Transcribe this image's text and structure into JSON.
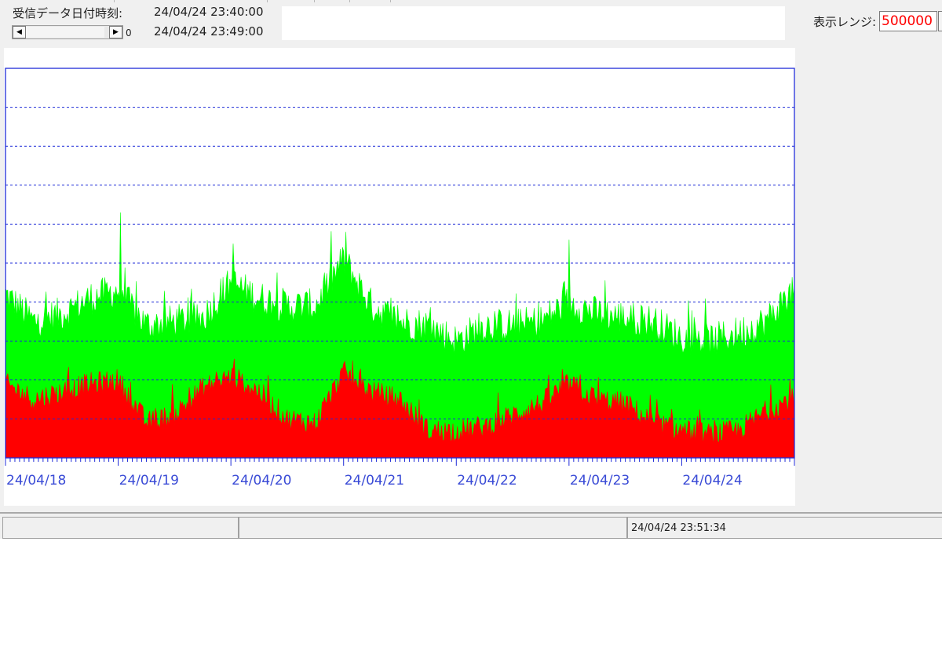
{
  "header": {
    "received_label": "受信データ日付時刻:",
    "time_from": "24/04/24 23:40:00",
    "time_to": "24/04/24 23:49:00",
    "scroll_value": "0",
    "scroll_left_icon": "◀",
    "scroll_right_icon": "▶"
  },
  "range": {
    "label": "表示レンジ:",
    "value": "500000"
  },
  "colors": {
    "series_total": "#00ff00",
    "series_part": "#ff0000",
    "axis": "#1f2bd8",
    "grid": "#1f2bd8",
    "tick_label": "#3a4bd6"
  },
  "chart_data": {
    "type": "area",
    "title": "",
    "xlabel": "",
    "ylabel": "",
    "x_tick_labels": [
      "24/04/18",
      "24/04/19",
      "24/04/20",
      "24/04/21",
      "24/04/22",
      "24/04/23",
      "24/04/24"
    ],
    "ylim": [
      0,
      500000
    ],
    "y_gridlines": [
      50000,
      100000,
      150000,
      200000,
      250000,
      300000,
      350000,
      400000,
      450000
    ],
    "grid": true,
    "grid_style": "dotted",
    "legend": "none",
    "hourly_ticks_per_day": 24,
    "series": [
      {
        "color": "#00ff00",
        "x": [
          "24/04/18 00:00",
          "24/04/18 06:00",
          "24/04/18 12:00",
          "24/04/18 18:00",
          "24/04/19 00:00",
          "24/04/19 06:00",
          "24/04/19 12:00",
          "24/04/19 18:00",
          "24/04/20 00:00",
          "24/04/20 06:00",
          "24/04/20 12:00",
          "24/04/20 18:00",
          "24/04/21 00:00",
          "24/04/21 06:00",
          "24/04/21 12:00",
          "24/04/21 18:00",
          "24/04/22 00:00",
          "24/04/22 06:00",
          "24/04/22 12:00",
          "24/04/22 18:00",
          "24/04/23 00:00",
          "24/04/23 06:00",
          "24/04/23 12:00",
          "24/04/23 18:00",
          "24/04/24 00:00",
          "24/04/24 06:00",
          "24/04/24 12:00",
          "24/04/24 18:00",
          "24/04/24 23:00"
        ],
        "values": [
          210000,
          175000,
          185000,
          205000,
          215000,
          170000,
          175000,
          180000,
          225000,
          205000,
          195000,
          195000,
          255000,
          195000,
          175000,
          170000,
          150000,
          170000,
          170000,
          175000,
          200000,
          185000,
          180000,
          175000,
          155000,
          150000,
          160000,
          175000,
          210000
        ]
      },
      {
        "color": "#ff0000",
        "x": [
          "24/04/18 00:00",
          "24/04/18 06:00",
          "24/04/18 12:00",
          "24/04/18 18:00",
          "24/04/19 00:00",
          "24/04/19 06:00",
          "24/04/19 12:00",
          "24/04/19 18:00",
          "24/04/20 00:00",
          "24/04/20 06:00",
          "24/04/20 12:00",
          "24/04/20 18:00",
          "24/04/21 00:00",
          "24/04/21 06:00",
          "24/04/21 12:00",
          "24/04/21 18:00",
          "24/04/22 00:00",
          "24/04/22 06:00",
          "24/04/22 12:00",
          "24/04/22 18:00",
          "24/04/23 00:00",
          "24/04/23 06:00",
          "24/04/23 12:00",
          "24/04/23 18:00",
          "24/04/24 00:00",
          "24/04/24 06:00",
          "24/04/24 12:00",
          "24/04/24 18:00",
          "24/04/24 23:00"
        ],
        "values": [
          95000,
          75000,
          85000,
          95000,
          100000,
          45000,
          55000,
          90000,
          105000,
          85000,
          50000,
          45000,
          110000,
          85000,
          75000,
          35000,
          35000,
          40000,
          55000,
          70000,
          95000,
          75000,
          70000,
          45000,
          35000,
          30000,
          35000,
          60000,
          75000
        ]
      }
    ],
    "spikes": [
      {
        "x": "24/04/19 00:30",
        "value": 315000
      },
      {
        "x": "24/04/20 00:30",
        "value": 275000
      },
      {
        "x": "24/04/21 00:30",
        "value": 290000
      },
      {
        "x": "24/04/23 00:00",
        "value": 280000
      }
    ]
  },
  "status_bar": {
    "cell1": "",
    "cell2": "",
    "clock": "24/04/24 23:51:34"
  }
}
